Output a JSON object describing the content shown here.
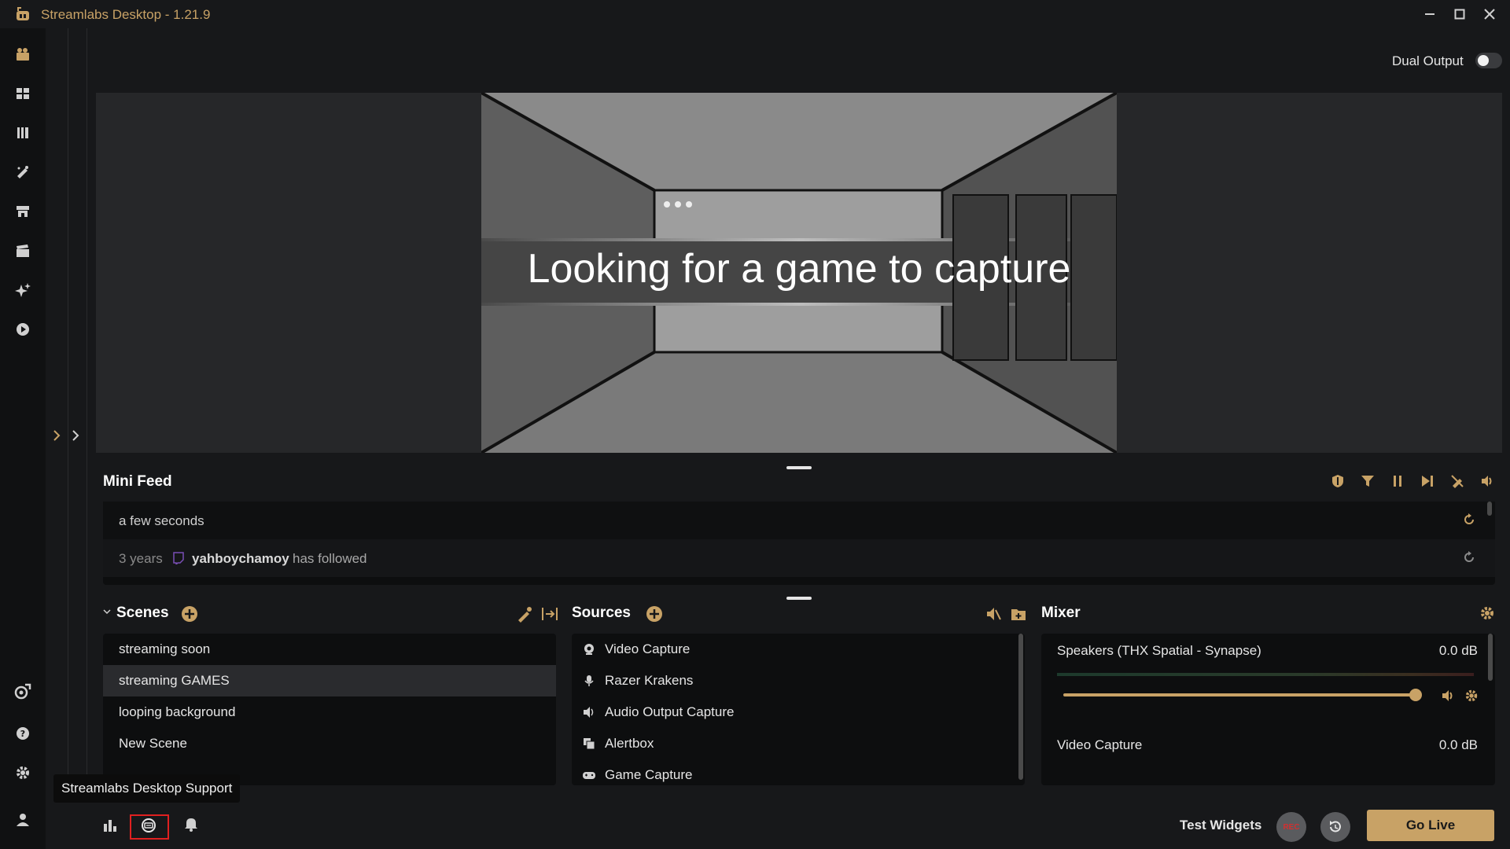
{
  "window": {
    "title": "Streamlabs Desktop - 1.21.9"
  },
  "colors": {
    "accent": "#c8a266",
    "background": "#17181a",
    "panel": "#0d0e0f",
    "highlight_box": "#e02020"
  },
  "leftnav": {
    "items": [
      {
        "name": "editor-icon"
      },
      {
        "name": "layout-editor-icon"
      },
      {
        "name": "library-icon"
      },
      {
        "name": "themes-icon"
      },
      {
        "name": "store-icon"
      },
      {
        "name": "highlighter-icon"
      },
      {
        "name": "ai-icon"
      },
      {
        "name": "play-icon"
      }
    ],
    "bottom_items": [
      {
        "name": "ultra-icon"
      },
      {
        "name": "help-icon"
      },
      {
        "name": "settings-icon"
      },
      {
        "name": "user-icon"
      }
    ]
  },
  "header": {
    "dual_output_label": "Dual Output",
    "dual_output_enabled": false
  },
  "preview": {
    "message": "Looking for a game to capture"
  },
  "minifeed": {
    "title": "Mini Feed",
    "controls": [
      "shield-icon",
      "filter-icon",
      "pause-icon",
      "skip-icon",
      "mute-alert-icon",
      "volume-icon"
    ],
    "rows": [
      {
        "time": "a few seconds",
        "user": "",
        "action": ""
      },
      {
        "time": "3 years",
        "user": "yahboychamoy",
        "action": "has followed"
      }
    ]
  },
  "scenes": {
    "title": "Scenes",
    "items": [
      {
        "label": "streaming soon",
        "selected": false
      },
      {
        "label": "streaming GAMES",
        "selected": true
      },
      {
        "label": "looping background",
        "selected": false
      },
      {
        "label": "New Scene",
        "selected": false
      }
    ]
  },
  "sources": {
    "title": "Sources",
    "items": [
      {
        "label": "Video Capture",
        "icon": "webcam-icon"
      },
      {
        "label": "Razer Krakens",
        "icon": "microphone-icon"
      },
      {
        "label": "Audio Output Capture",
        "icon": "speaker-icon"
      },
      {
        "label": "Alertbox",
        "icon": "alertbox-icon"
      },
      {
        "label": "Game Capture",
        "icon": "gamepad-icon"
      }
    ]
  },
  "mixer": {
    "title": "Mixer",
    "channels": [
      {
        "name": "Speakers (THX Spatial - Synapse)",
        "db": "0.0 dB",
        "volume": 1.0
      },
      {
        "name": "Video Capture",
        "db": "0.0 dB",
        "volume": 1.0
      }
    ]
  },
  "bottombar": {
    "tooltip": "Streamlabs Desktop Support",
    "test_widgets": "Test Widgets",
    "rec_label": "REC",
    "go_live": "Go Live"
  }
}
